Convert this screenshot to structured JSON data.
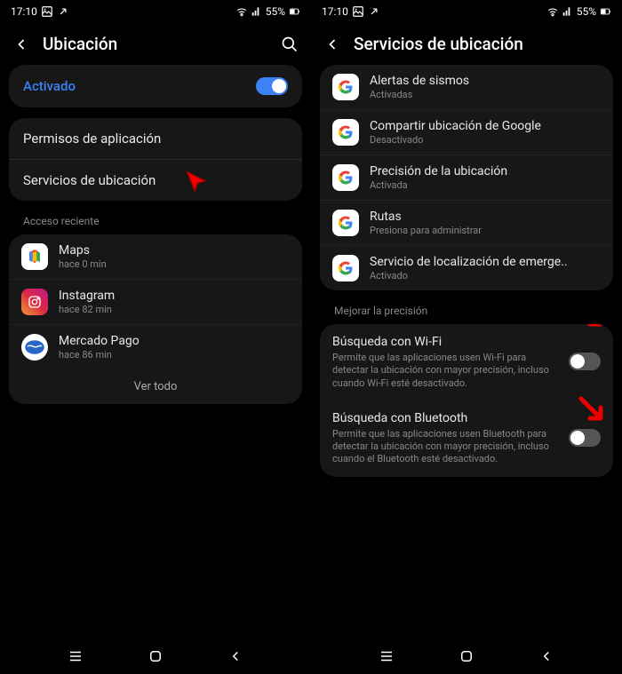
{
  "status": {
    "time": "17:10",
    "battery": "55%"
  },
  "left_screen": {
    "title": "Ubicación",
    "activated_label": "Activado",
    "permissions_label": "Permisos de aplicación",
    "services_label": "Servicios de ubicación",
    "recent_access_label": "Acceso reciente",
    "apps": [
      {
        "name": "Maps",
        "time": "hace 0 min"
      },
      {
        "name": "Instagram",
        "time": "hace 82 min"
      },
      {
        "name": "Mercado Pago",
        "time": "hace 86 min"
      }
    ],
    "see_all": "Ver todo"
  },
  "right_screen": {
    "title": "Servicios de ubicación",
    "services": [
      {
        "name": "Alertas de sismos",
        "status": "Activadas"
      },
      {
        "name": "Compartir ubicación de Google",
        "status": "Desactivado"
      },
      {
        "name": "Precisión de la ubicación",
        "status": "Activada"
      },
      {
        "name": "Rutas",
        "status": "Presiona para administrar"
      },
      {
        "name": "Servicio de localización de emerge..",
        "status": "Activado"
      }
    ],
    "improve_precision_label": "Mejorar la precisión",
    "wifi_title": "Búsqueda con Wi-Fi",
    "wifi_desc": "Permite que las aplicaciones usen Wi-Fi para detectar la ubicación con mayor precisión, incluso cuando Wi-Fi esté desactivado.",
    "bt_title": "Búsqueda con Bluetooth",
    "bt_desc": "Permite que las aplicaciones usen Bluetooth para detectar la ubicación con mayor precisión, incluso cuando el Bluetooth esté desactivado."
  }
}
